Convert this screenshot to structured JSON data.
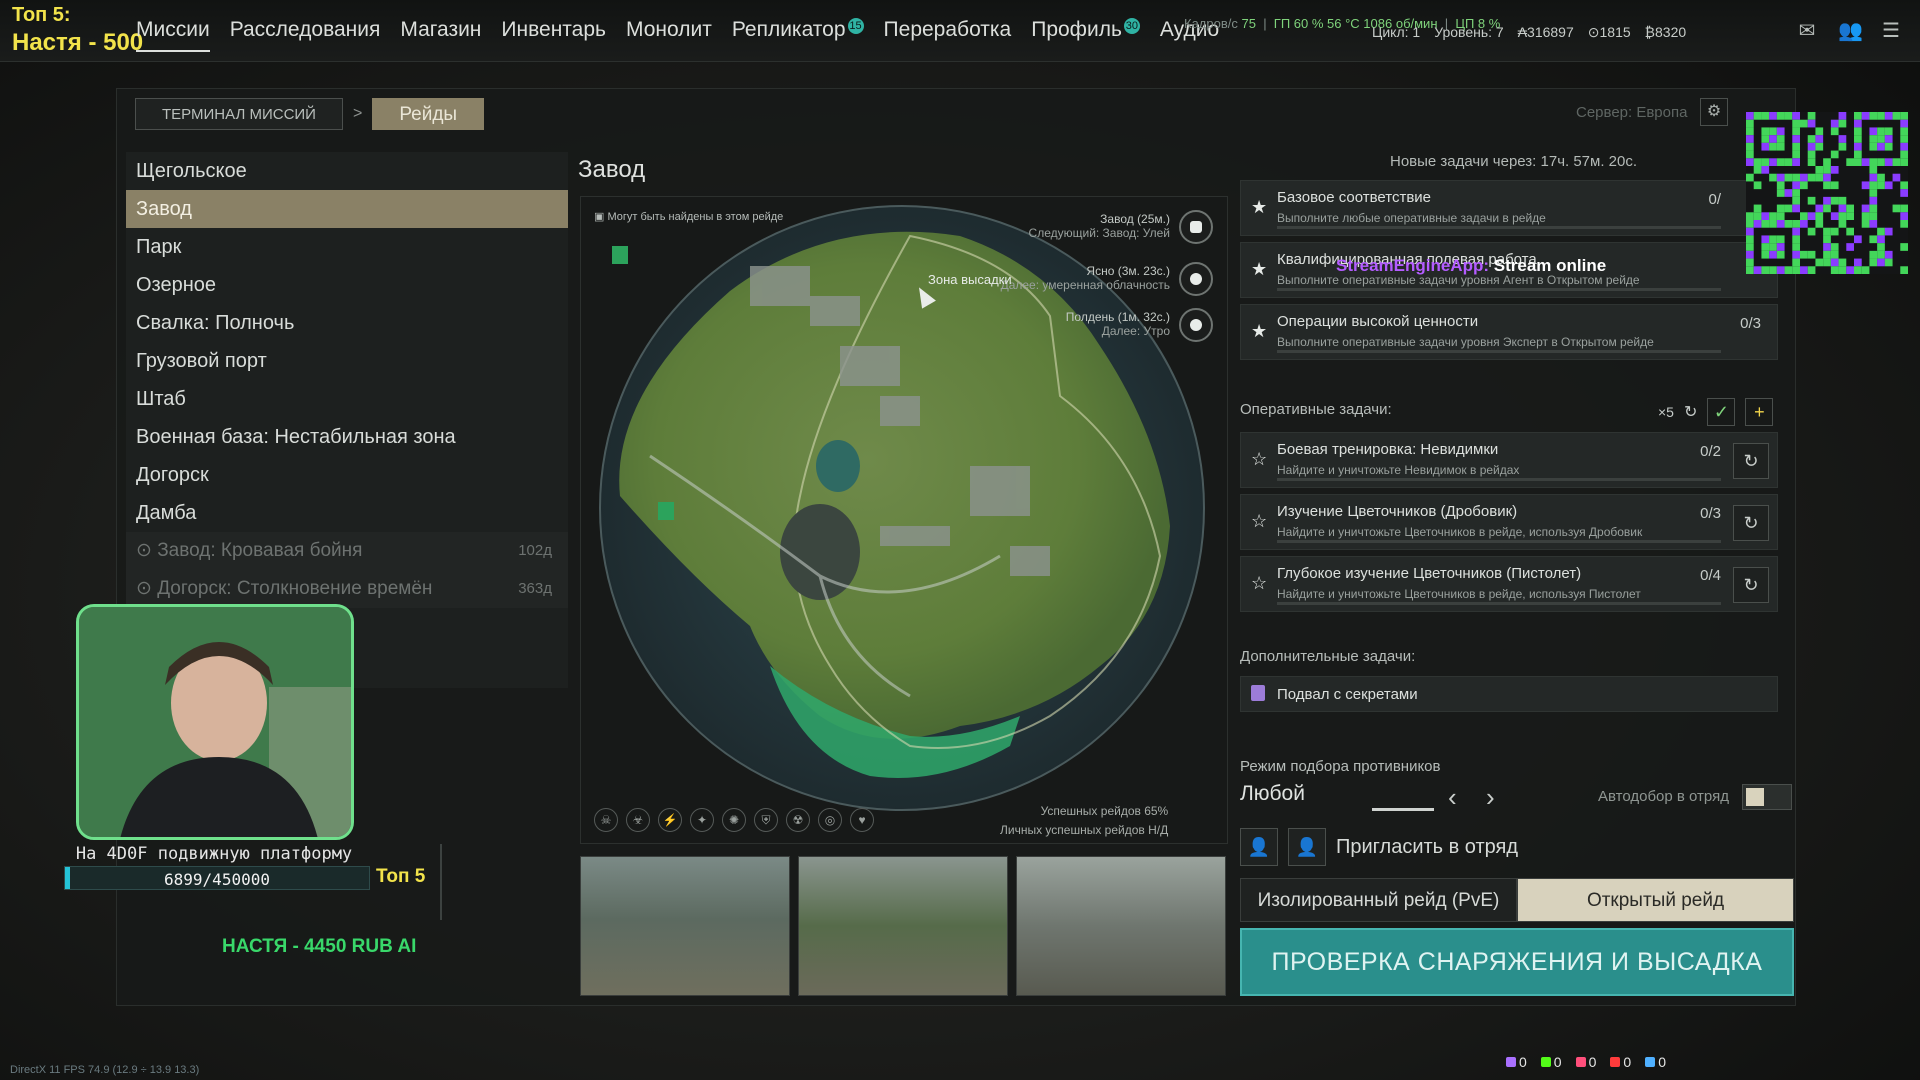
{
  "overlay": {
    "top_label": "Топ 5:",
    "top_name": "Настя - 500",
    "donation_goal_text": "На 4D0F подвижную платформу",
    "donation_progress": "6899/450000",
    "donation_fraction": 0.0153,
    "donation_top": "Топ 5",
    "ticker": "НАСТЯ - 4450 RUB  AI",
    "stream_app": "StreamEngineApp:",
    "stream_status": "Stream online",
    "fps": "DirectX 11 FPS 74.9 (12.9 ÷ 13.9 13.3)",
    "chat_counters": [
      {
        "color": "#a970ff",
        "value": "0"
      },
      {
        "color": "#53fc18",
        "value": "0"
      },
      {
        "color": "#ff4f7b",
        "value": "0"
      },
      {
        "color": "#ff3b3b",
        "value": "0"
      },
      {
        "color": "#4fb0ff",
        "value": "0"
      }
    ]
  },
  "nav": {
    "items": [
      {
        "label": "Миссии",
        "badge": ""
      },
      {
        "label": "Расследования",
        "badge": ""
      },
      {
        "label": "Магазин",
        "badge": ""
      },
      {
        "label": "Инвентарь",
        "badge": ""
      },
      {
        "label": "Монолит",
        "badge": ""
      },
      {
        "label": "Репликатор",
        "badge": "15"
      },
      {
        "label": "Переработка",
        "badge": ""
      },
      {
        "label": "Профиль",
        "badge": "30"
      },
      {
        "label": "Аудио",
        "badge": ""
      }
    ]
  },
  "perf": {
    "fps_label": "Кадров/с",
    "fps": "75",
    "gpu": "ГП  60 %  56 °C  1086 об/мин",
    "cpu": "ЦП  8 %"
  },
  "stats": {
    "cycle": "Цикл: 1",
    "level": "Уровень: 7",
    "currency1": "₳316897",
    "currency2": "⊙1815",
    "currency3": "₿8320"
  },
  "breadcrumb": {
    "root": "ТЕРМИНАЛ МИССИЙ",
    "sep": ">",
    "current": "Рейды"
  },
  "server": "Сервер: Европа",
  "locations": [
    {
      "label": "Щегольское",
      "state": "normal",
      "days": ""
    },
    {
      "label": "Завод",
      "state": "selected",
      "days": ""
    },
    {
      "label": "Парк",
      "state": "normal",
      "days": ""
    },
    {
      "label": "Озерное",
      "state": "normal",
      "days": ""
    },
    {
      "label": "Свалка: Полночь",
      "state": "normal",
      "days": ""
    },
    {
      "label": "Грузовой порт",
      "state": "normal",
      "days": ""
    },
    {
      "label": "Штаб",
      "state": "normal",
      "days": ""
    },
    {
      "label": "Военная база: Нестабильная зона",
      "state": "normal",
      "days": ""
    },
    {
      "label": "Догорск",
      "state": "normal",
      "days": ""
    },
    {
      "label": "Дамба",
      "state": "normal",
      "days": ""
    },
    {
      "label": "⊙ Завод: Кровавая бойня",
      "state": "disabled",
      "days": "102д"
    },
    {
      "label": "⊙ Догорск: Столкновение времён",
      "state": "disabled",
      "days": "363д"
    }
  ],
  "map": {
    "title": "Завод",
    "hint": "Могут быть найдены в этом рейде",
    "zone_line1": "Завод (25м.)",
    "zone_line2": "Следующий: Завод: Улей",
    "weather_line1": "Ясно (3м. 23с.)",
    "weather_line2": "Далее: умеренная облачность",
    "time_line1": "Полдень (1м. 32с.)",
    "time_line2": "Далее: Утро",
    "landing": "Зона высадки",
    "success_rate": "Успешных рейдов 65%",
    "personal_rate": "Личных успешных рейдов Н/Д",
    "modifier_icons": [
      "skull-icon",
      "biohazard-icon",
      "bolt-icon",
      "star-icon",
      "anomaly-icon",
      "shield-icon",
      "radiation-icon",
      "target-icon",
      "heart-icon"
    ]
  },
  "right": {
    "new_tasks": "Новые задачи через: 17ч. 57м. 20с.",
    "base_tasks": [
      {
        "title": "Базовое соответствие",
        "desc": "Выполните любые оперативные задачи в рейде",
        "count": "0/"
      },
      {
        "title": "Квалифицированная полевая работа",
        "desc": "Выполните оперативные задачи уровня Агент в Открытом рейде",
        "count": ""
      },
      {
        "title": "Операции высокой ценности",
        "desc": "Выполните оперативные задачи уровня Эксперт в Открытом рейде",
        "count": "0/3"
      }
    ],
    "op_header": "Оперативные задачи:",
    "op_refresh": "×5",
    "op_tasks": [
      {
        "title": "Боевая тренировка: Невидимки",
        "desc": "Найдите и уничтожьте Невидимок в рейдах",
        "count": "0/2"
      },
      {
        "title": "Изучение Цветочников (Дробовик)",
        "desc": "Найдите и уничтожьте Цветочников в рейде, используя Дробовик",
        "count": "0/3"
      },
      {
        "title": "Глубокое изучение Цветочников (Пистолет)",
        "desc": "Найдите и уничтожьте Цветочников в рейде, используя Пистолет",
        "count": "0/4"
      }
    ],
    "extra_header": "Дополнительные задачи:",
    "extra_task": "Подвал с секретами",
    "mm_label": "Режим подбора противников",
    "mm_value": "Любой",
    "auto_label": "Автодобор в отряд",
    "invite": "Пригласить в отряд",
    "mode_pve": "Изолированный рейд (PvE)",
    "mode_open": "Открытый рейд",
    "launch": "ПРОВЕРКА СНАРЯЖЕНИЯ И ВЫСАДКА"
  }
}
